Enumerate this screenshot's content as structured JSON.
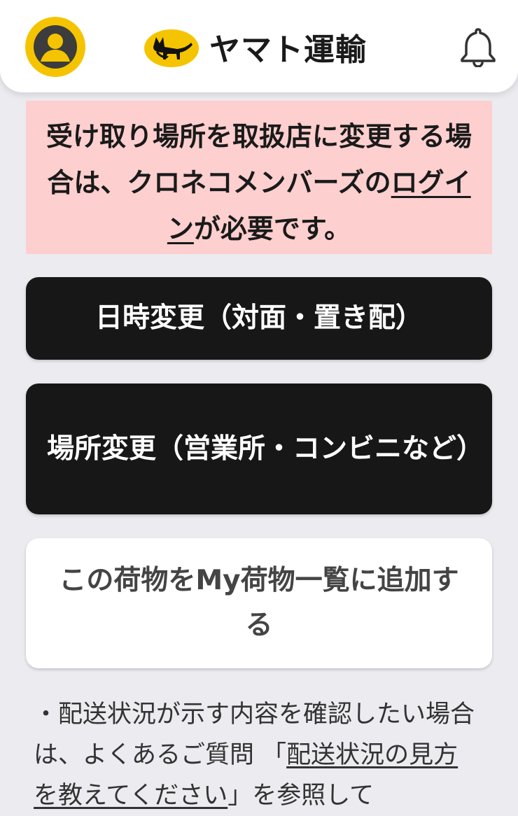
{
  "header": {
    "brand_name": "ヤマト運輸",
    "colors": {
      "brand_yellow": "#f5c400",
      "header_bg": "#ffffff"
    },
    "icons": {
      "avatar": "user-avatar-icon",
      "logo": "black-cat-logo",
      "notifications": "bell-icon"
    }
  },
  "notice": {
    "text_before": "受け取り場所を取扱店に変更する場合は、クロネコメンバーズの",
    "login_link": "ログイン",
    "text_after": "が必要です。",
    "bg_color": "#fdcfcf"
  },
  "buttons": {
    "date_change": "日時変更（対面・置き配）",
    "place_change": "場所変更（営業所・コンビニなど）",
    "add_my_parcels": "この荷物をMy荷物一覧に追加する"
  },
  "info": {
    "bullet": "・",
    "text_before": "配送状況が示す内容を確認したい場合は、よくあるご質問 「",
    "faq_link": "配送状況の見方を教えてください",
    "text_after": "」を参照して"
  }
}
